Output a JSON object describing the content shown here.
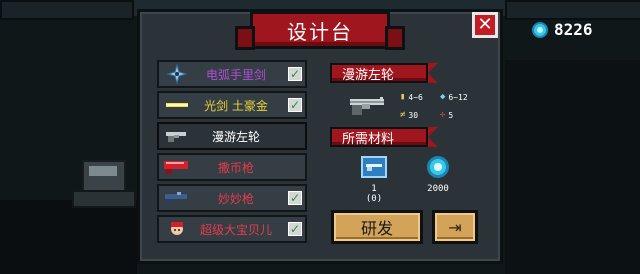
{
  "title": "设计台",
  "currency": {
    "icon": "gem-icon",
    "amount": "8226"
  },
  "weapons": [
    {
      "name": "电弧手里剑",
      "color": "#b24dd6",
      "icon": "shuriken-icon",
      "checked": true
    },
    {
      "name": "光剑 土豪金",
      "color": "#e9d234",
      "icon": "lightsaber-icon",
      "checked": true
    },
    {
      "name": "漫游左轮",
      "color": "#ffffff",
      "icon": "revolver-icon",
      "checked": false,
      "selected": true
    },
    {
      "name": "撒币枪",
      "color": "#e83a4c",
      "icon": "coin-gun-icon",
      "checked": false
    },
    {
      "name": "妙妙枪",
      "color": "#e83a4c",
      "icon": "wonder-gun-icon",
      "checked": true
    },
    {
      "name": "超级大宝贝儿",
      "color": "#e83a4c",
      "icon": "baby-weapon-icon",
      "checked": true
    }
  ],
  "detail": {
    "name": "漫游左轮",
    "stats": {
      "damage": "4~6",
      "energy": "6~12",
      "crit": "30",
      "spread": "5"
    }
  },
  "materials": {
    "label": "所需材料",
    "items": [
      {
        "icon": "revolver-blueprint-icon",
        "count": "1",
        "sub": "(0)"
      },
      {
        "icon": "gem-icon",
        "count": "2000",
        "sub": ""
      }
    ]
  },
  "buttons": {
    "develop": "研发",
    "exit_icon": "exit-icon"
  },
  "colors": {
    "accent_red": "#a0161e",
    "button_gold": "#d4a35a",
    "panel": "#2b3338"
  }
}
